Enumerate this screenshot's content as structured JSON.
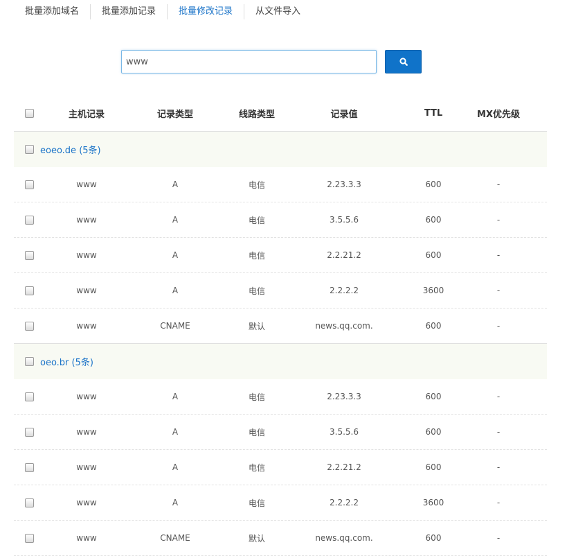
{
  "tabs": [
    {
      "label": "批量添加域名",
      "active": false
    },
    {
      "label": "批量添加记录",
      "active": false
    },
    {
      "label": "批量修改记录",
      "active": true
    },
    {
      "label": "从文件导入",
      "active": false
    }
  ],
  "search": {
    "value": "www",
    "button_icon": "search-icon"
  },
  "table": {
    "headers": {
      "host": "主机记录",
      "type": "记录类型",
      "line": "线路类型",
      "value": "记录值",
      "ttl": "TTL",
      "mx": "MX优先级"
    },
    "groups": [
      {
        "label": "eoeo.de (5条)",
        "rows": [
          {
            "host": "www",
            "type": "A",
            "line": "电信",
            "value": "2.23.3.3",
            "ttl": "600",
            "mx": "-"
          },
          {
            "host": "www",
            "type": "A",
            "line": "电信",
            "value": "3.5.5.6",
            "ttl": "600",
            "mx": "-"
          },
          {
            "host": "www",
            "type": "A",
            "line": "电信",
            "value": "2.2.21.2",
            "ttl": "600",
            "mx": "-"
          },
          {
            "host": "www",
            "type": "A",
            "line": "电信",
            "value": "2.2.2.2",
            "ttl": "3600",
            "mx": "-"
          },
          {
            "host": "www",
            "type": "CNAME",
            "line": "默认",
            "value": "news.qq.com.",
            "ttl": "600",
            "mx": "-"
          }
        ]
      },
      {
        "label": "oeo.br (5条)",
        "rows": [
          {
            "host": "www",
            "type": "A",
            "line": "电信",
            "value": "2.23.3.3",
            "ttl": "600",
            "mx": "-"
          },
          {
            "host": "www",
            "type": "A",
            "line": "电信",
            "value": "3.5.5.6",
            "ttl": "600",
            "mx": "-"
          },
          {
            "host": "www",
            "type": "A",
            "line": "电信",
            "value": "2.2.21.2",
            "ttl": "600",
            "mx": "-"
          },
          {
            "host": "www",
            "type": "A",
            "line": "电信",
            "value": "2.2.2.2",
            "ttl": "3600",
            "mx": "-"
          },
          {
            "host": "www",
            "type": "CNAME",
            "line": "默认",
            "value": "news.qq.com.",
            "ttl": "600",
            "mx": "-"
          }
        ]
      }
    ]
  },
  "colors": {
    "accent": "#1a73c8",
    "button": "#1073c9",
    "group_bg": "#f8faf3"
  }
}
